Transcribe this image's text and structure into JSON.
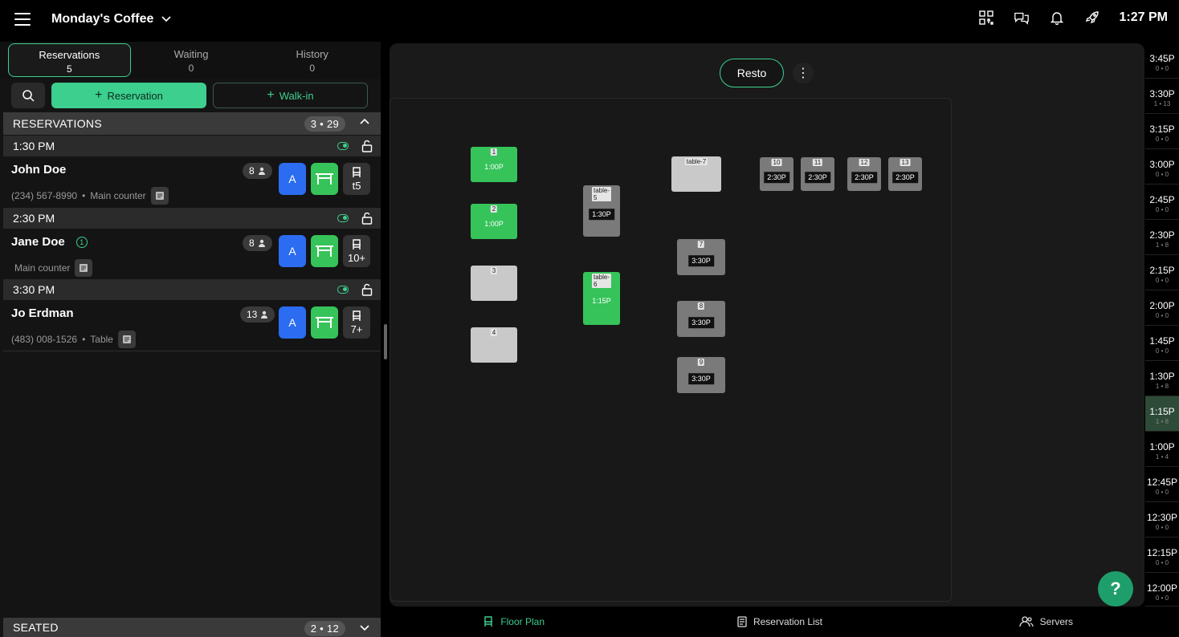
{
  "header": {
    "title": "Monday's Coffee",
    "time": "1:27 PM"
  },
  "tabs": [
    {
      "label": "Reservations",
      "count": "5"
    },
    {
      "label": "Waiting",
      "count": "0"
    },
    {
      "label": "History",
      "count": "0"
    }
  ],
  "actions": {
    "reservation_label": "Reservation",
    "walkin_label": "Walk-in"
  },
  "sections": {
    "reservations": {
      "title": "RESERVATIONS",
      "summary": "3 • 29"
    },
    "seated": {
      "title": "SEATED",
      "summary": "2 • 12"
    }
  },
  "slots": [
    {
      "time": "1:30 PM",
      "reservation": {
        "name": "John Doe",
        "phone": "(234) 567-8990",
        "area": "Main counter",
        "party": "8",
        "server": "A",
        "seats": "t5"
      }
    },
    {
      "time": "2:30 PM",
      "reservation": {
        "name": "Jane Doe",
        "badge": "1",
        "phone": "",
        "area": "Main counter",
        "party": "8",
        "server": "A",
        "seats": "10+"
      }
    },
    {
      "time": "3:30 PM",
      "reservation": {
        "name": "Jo Erdman",
        "phone": "(483) 008-1526",
        "area": "Table",
        "party": "13",
        "server": "A",
        "seats": "7+"
      }
    }
  ],
  "floor": {
    "area_label": "Resto",
    "tables": [
      {
        "id": "1",
        "time": "1:00P",
        "state": "green"
      },
      {
        "id": "2",
        "time": "1:00P",
        "state": "green"
      },
      {
        "id": "3",
        "time": "",
        "state": "light"
      },
      {
        "id": "4",
        "time": "",
        "state": "light"
      },
      {
        "id": "table-5",
        "time": "1:30P",
        "state": "grey"
      },
      {
        "id": "table-6",
        "time": "1:15P",
        "state": "green"
      },
      {
        "id": "table-7",
        "time": "",
        "state": "light"
      },
      {
        "id": "7",
        "time": "3:30P",
        "state": "grey"
      },
      {
        "id": "8",
        "time": "3:30P",
        "state": "grey"
      },
      {
        "id": "9",
        "time": "3:30P",
        "state": "grey"
      },
      {
        "id": "10",
        "time": "2:30P",
        "state": "grey"
      },
      {
        "id": "11",
        "time": "2:30P",
        "state": "grey"
      },
      {
        "id": "12",
        "time": "2:30P",
        "state": "grey"
      },
      {
        "id": "13",
        "time": "2:30P",
        "state": "grey"
      }
    ]
  },
  "timeline": [
    {
      "time": "3:45P",
      "sub": "0 • 0"
    },
    {
      "time": "3:30P",
      "sub": "1 • 13"
    },
    {
      "time": "3:15P",
      "sub": "0 • 0"
    },
    {
      "time": "3:00P",
      "sub": "0 • 0"
    },
    {
      "time": "2:45P",
      "sub": "0 • 0"
    },
    {
      "time": "2:30P",
      "sub": "1 • 8"
    },
    {
      "time": "2:15P",
      "sub": "0 • 0"
    },
    {
      "time": "2:00P",
      "sub": "0 • 0"
    },
    {
      "time": "1:45P",
      "sub": "0 • 0"
    },
    {
      "time": "1:30P",
      "sub": "1 • 8"
    },
    {
      "time": "1:15P",
      "sub": "1 • 8"
    },
    {
      "time": "1:00P",
      "sub": "1 • 4"
    },
    {
      "time": "12:45P",
      "sub": "0 • 0"
    },
    {
      "time": "12:30P",
      "sub": "0 • 0"
    },
    {
      "time": "12:15P",
      "sub": "0 • 0"
    },
    {
      "time": "12:00P",
      "sub": "0 • 0"
    }
  ],
  "bottom_nav": [
    {
      "label": "Floor Plan"
    },
    {
      "label": "Reservation List"
    },
    {
      "label": "Servers"
    }
  ],
  "help_label": "?",
  "colors": {
    "accent": "#3ccf8e",
    "table_green": "#36c35a",
    "server_blue": "#2b6cf0"
  }
}
